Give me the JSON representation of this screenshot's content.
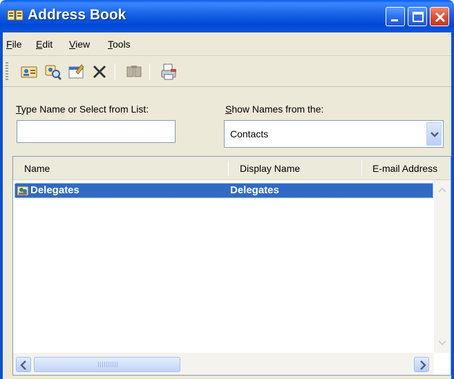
{
  "window": {
    "title": "Address Book",
    "icon": "address-book-icon",
    "controls": [
      "minimize-icon",
      "maximize-icon",
      "close-icon"
    ]
  },
  "menu": {
    "file": {
      "key": "F",
      "rest": "ile"
    },
    "edit": {
      "key": "E",
      "rest": "dit"
    },
    "view": {
      "key": "V",
      "rest": "iew"
    },
    "tools": {
      "key": "T",
      "rest": "ools"
    }
  },
  "toolbar": {
    "items": [
      "new-contact-icon",
      "find-people-icon",
      "properties-icon",
      "delete-icon",
      "book-icon",
      "print-icon"
    ]
  },
  "search": {
    "label_key": "T",
    "label_rest": "ype Name or Select from List:",
    "value": "",
    "placeholder": ""
  },
  "source": {
    "label_key": "S",
    "label_rest": "how Names from the:",
    "selected": "Contacts"
  },
  "list": {
    "columns": [
      "Name",
      "Display Name",
      "E-mail Address"
    ],
    "rows": [
      {
        "name": "Delegates",
        "display_name": "Delegates",
        "email": "",
        "selected": true,
        "icon": "distribution-group-icon"
      }
    ]
  },
  "colors": {
    "titlebar": "#0a55dd",
    "selection": "#316ac5",
    "face": "#ece9d8"
  }
}
